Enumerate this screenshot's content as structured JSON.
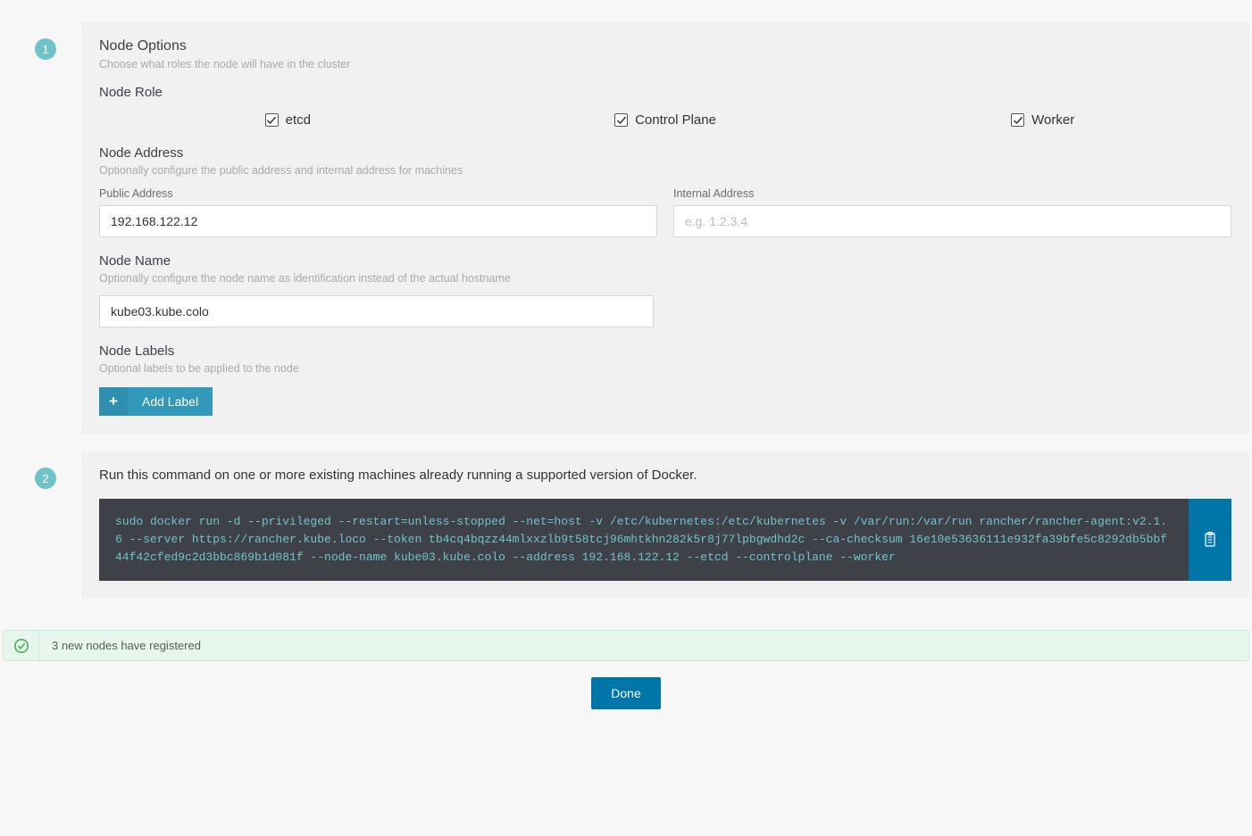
{
  "step1": {
    "badge": "1",
    "title": "Node Options",
    "subtitle": "Choose what roles the node will have in the cluster",
    "role": {
      "title": "Node Role",
      "items": [
        "etcd",
        "Control Plane",
        "Worker"
      ]
    },
    "address": {
      "title": "Node Address",
      "subtitle": "Optionally configure the public address and internal address for machines",
      "public_label": "Public Address",
      "public_value": "192.168.122.12",
      "internal_label": "Internal Address",
      "internal_placeholder": "e.g. 1.2.3.4"
    },
    "name": {
      "title": "Node Name",
      "subtitle": "Optionally configure the node name as identification instead of the actual hostname",
      "value": "kube03.kube.colo"
    },
    "labels": {
      "title": "Node Labels",
      "subtitle": "Optional labels to be applied to the node",
      "button": "Add Label"
    }
  },
  "step2": {
    "badge": "2",
    "text": "Run this command on one or more existing machines already running a supported version of Docker.",
    "command": "sudo docker run -d --privileged --restart=unless-stopped --net=host -v /etc/kubernetes:/etc/kubernetes -v /var/run:/var/run rancher/rancher-agent:v2.1.6 --server https://rancher.kube.loco --token tb4cq4bqzz44mlxxzlb9t58tcj96mhtkhn282k5r8j77lpbgwdhd2c --ca-checksum 16e10e53636111e932fa39bfe5c8292db5bbf44f42cfed9c2d3bbc869b1d081f --node-name kube03.kube.colo --address 192.168.122.12 --etcd --controlplane --worker"
  },
  "alert": {
    "message": "3 new nodes have registered"
  },
  "done": "Done"
}
